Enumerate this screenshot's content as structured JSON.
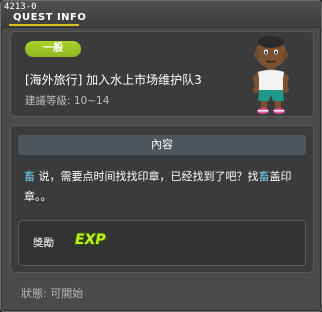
{
  "window": {
    "quest_id": "4213-0",
    "title": "QUEST INFO"
  },
  "quest": {
    "category": "一般",
    "name": "[海外旅行] 加入水上市场维护队3",
    "level": "建議等級: 10~14",
    "npc_icon": "npc-character-avatar"
  },
  "content": {
    "header": "內容",
    "npc_name_1": "畜",
    "text_1": " 说，需要点时间找找印章，已经找到了吧？找",
    "npc_name_2": "畜",
    "text_2": "盖印章。。"
  },
  "reward": {
    "label": "獎勵",
    "exp_text": "EXP"
  },
  "status": {
    "text": "狀態: 可開始"
  },
  "colors": {
    "window_bg": "#4a4a4a",
    "panel_bg": "#3b3b3b",
    "badge_green": "#a9d22b",
    "title_underline": "#d9c21a",
    "npc_text": "#6fd3f2",
    "exp_color": "#c6ef1f"
  }
}
